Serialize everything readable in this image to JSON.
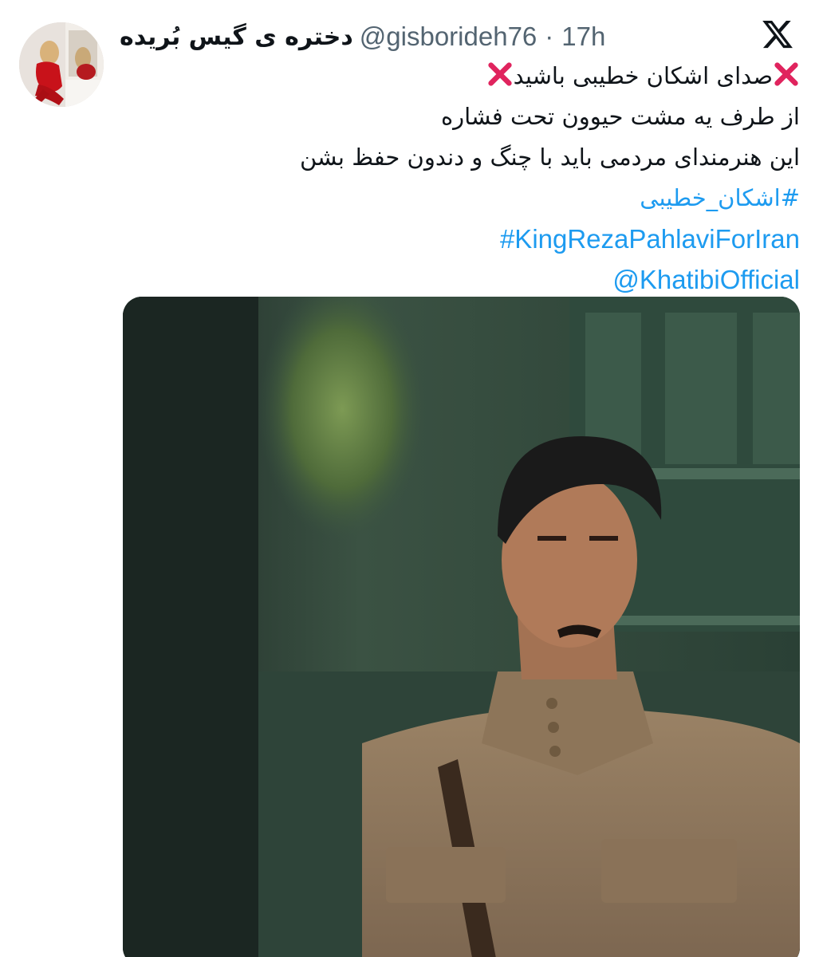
{
  "tweet": {
    "display_name": "دختره ی گیس بُریده",
    "handle": "@gisborideh76",
    "separator": "·",
    "time": "17h",
    "lines": [
      "صدای اشکان خطیبی باشید",
      "از طرف یه مشت حیوون تحت فشاره",
      "این هنرمندای مردمی باید با چنگ و دندون حفظ بشن"
    ],
    "hashtag_fa": "#اشکان_خطیبی",
    "hashtag_en": "#KingRezaPahlaviForIran",
    "mention": "@KhatibiOfficial"
  },
  "icons": {
    "logo": "x-logo-icon",
    "emoji": "cross-mark-icon"
  },
  "colors": {
    "link": "#1d9bf0",
    "secondary_text": "#536471",
    "primary_text": "#0f1419",
    "cross_red": "#e0245e"
  }
}
